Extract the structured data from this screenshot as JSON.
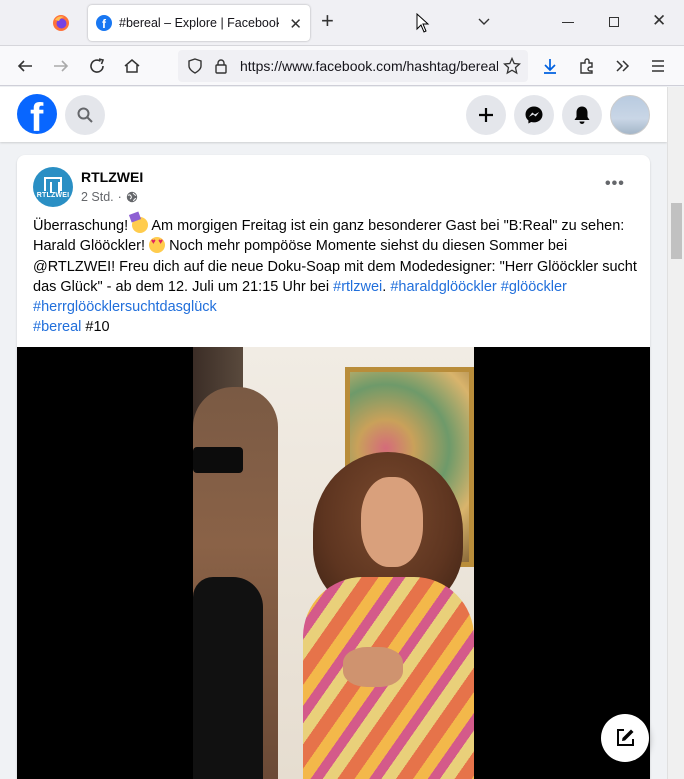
{
  "browser": {
    "tab_title": "#bereal – Explore | Facebook",
    "tab_favicon": "f",
    "tab_close": "✕",
    "newtab": "+",
    "url": "https://www.facebook.com/hashtag/bereal",
    "window_close": "✕"
  },
  "facebook": {
    "logo": "f"
  },
  "post": {
    "page_name": "RTLZWEI",
    "avatar_word": "RTLZWEI",
    "time": "2 Std.",
    "dot": "·",
    "more": "•••",
    "text": {
      "p1": "Überraschung! ",
      "p2": " Am morgigen Freitag ist ein ganz besonderer Gast bei \"B:Real\" zu sehen: Harald Glööckler! ",
      "p3": " Noch mehr pompööse Momente siehst du diesen Sommer bei @RTLZWEI! Freu dich auf die neue Doku-Soap mit dem Modedesigner: \"Herr Glööckler sucht das Glück\" - ab dem 12. Juli um 21:15 Uhr bei ",
      "tag1": "#rtlzwei",
      "sep1": ". ",
      "tag2": "#haraldglööckler",
      "sep2": " ",
      "tag3": "#glööckler",
      "sep3": " ",
      "tag4": "#herrglööcklersuchtdasglück",
      "tag5": "#bereal",
      "p4": " #10"
    }
  },
  "colors": {
    "fb_blue": "#0866ff",
    "link": "#216fdb",
    "meta": "#65676b"
  },
  "icons": [
    "firefox-icon",
    "facebook-favicon",
    "close-icon",
    "plus-icon",
    "cursor-icon",
    "chevron-down-icon",
    "minimize-icon",
    "maximize-icon",
    "back-icon",
    "forward-icon",
    "reload-icon",
    "home-icon",
    "shield-icon",
    "lock-icon",
    "star-icon",
    "download-icon",
    "extensions-icon",
    "overflow-icon",
    "menu-icon",
    "search-icon",
    "messenger-icon",
    "bell-icon",
    "globe-icon",
    "edit-icon"
  ]
}
